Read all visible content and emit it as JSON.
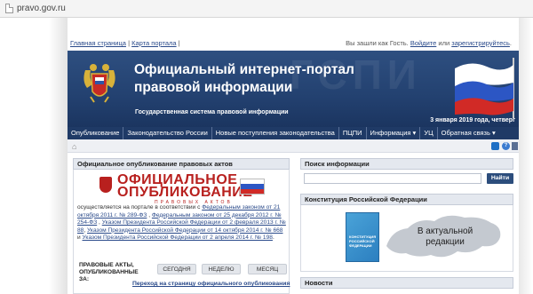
{
  "browser": {
    "address": "pravo.gov.ru"
  },
  "toplinks": {
    "home": "Главная страница",
    "sep": "|",
    "map": "Карта портала",
    "sep2": "|"
  },
  "user": {
    "greeting": "Вы зашли как Гость.",
    "login": "Войдите",
    "or": "или",
    "register": "зарегистрируйтесь",
    "tail": "."
  },
  "header": {
    "title_line1": "Официальный интернет-портал",
    "title_line2": "правовой информации",
    "subtitle": "Государственная система правовой информации",
    "watermark": "ГСПИ",
    "date": "3 января 2019 года, четверг"
  },
  "nav": {
    "items": [
      "Опубликование",
      "Законодательство России",
      "Новые поступления законодательства",
      "ПЦПИ",
      "Информация ▾",
      "УЦ",
      "Обратная связь ▾"
    ]
  },
  "left_panel": {
    "title": "Официальное опубликование правовых актов",
    "logo_line1": "ОФИЦИАЛЬНОЕ",
    "logo_line2": "ОПУБЛИКОВАНИЕ",
    "logo_line3": "ПРАВОВЫХ АКТОВ",
    "text_start": "осуществляется на портале в соответствии с ",
    "link1": "Федеральным законом от 21 октября 2011 г. № 289-ФЗ",
    "sep1": " , ",
    "link2": "Федеральным законом от 25 декабря 2012 г. № 254-ФЗ",
    "sep2": " , ",
    "link3": "Указом Президента Российской Федерации от 2 февраля 2013 г. № 88",
    "sep3": ", ",
    "link4": "Указом Президента Российской Федерации от 14 октября 2014 г. № 668",
    "sep4": " и ",
    "link5": "Указом Президента Российской Федерации от 2 апреля 2014 г. № 198",
    "text_end": ".",
    "period_label": "ПРАВОВЫЕ АКТЫ, ОПУБЛИКОВАННЫЕ ЗА:",
    "btn_today": "СЕГОДНЯ",
    "btn_week": "НЕДЕЛЮ",
    "btn_month": "МЕСЯЦ",
    "to_page": "Переход на страницу официального опубликования"
  },
  "search": {
    "title": "Поиск информации",
    "value": "",
    "button": "Найти"
  },
  "constitution": {
    "title": "Конституция Российской Федерации",
    "book_text": "КОНСТИТУЦИЯ РОССИЙСКОЙ ФЕДЕРАЦИИ",
    "map_text": "В актуальной редакции"
  },
  "news": {
    "title": "Новости"
  },
  "colors": {
    "banner": "#234170",
    "nav": "#1f3a66",
    "accent_red": "#b8201e",
    "link": "#2a4a8a"
  },
  "icons": [
    "home-icon",
    "twitter-icon",
    "help-icon",
    "print-icon",
    "emblem-icon",
    "flag-icon"
  ]
}
